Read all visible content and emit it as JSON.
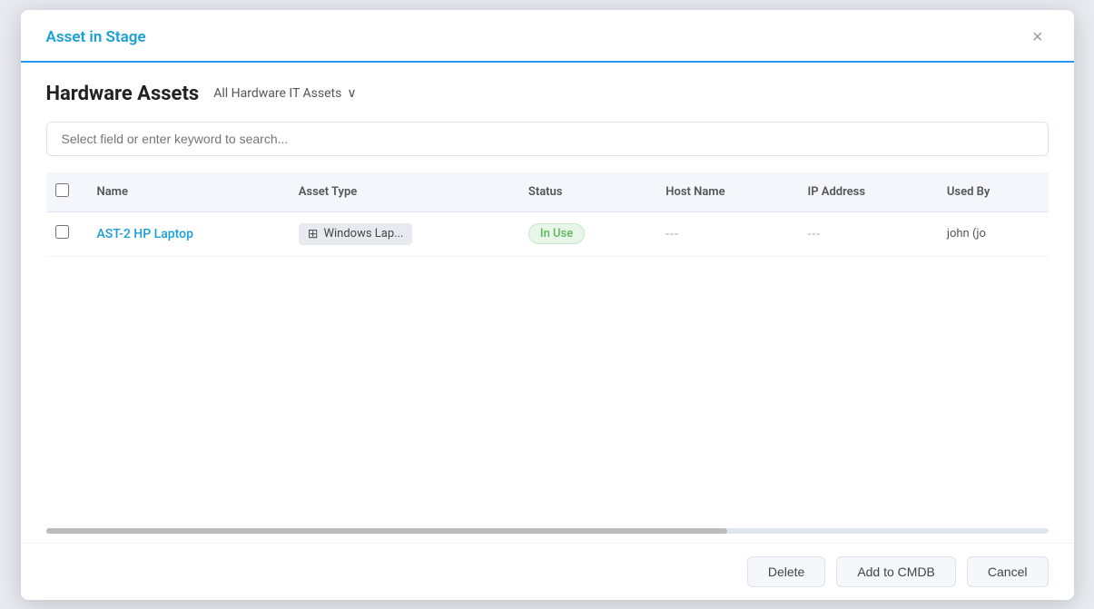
{
  "modal": {
    "title": "Asset in Stage",
    "close_label": "×"
  },
  "header": {
    "page_title": "Hardware Assets",
    "filter_label": "All Hardware IT Assets",
    "filter_chevron": "∨"
  },
  "search": {
    "placeholder": "Select field or enter keyword to search..."
  },
  "table": {
    "columns": [
      {
        "id": "checkbox",
        "label": ""
      },
      {
        "id": "name",
        "label": "Name"
      },
      {
        "id": "asset_type",
        "label": "Asset Type"
      },
      {
        "id": "status",
        "label": "Status"
      },
      {
        "id": "host_name",
        "label": "Host Name"
      },
      {
        "id": "ip_address",
        "label": "IP Address"
      },
      {
        "id": "used_by",
        "label": "Used By"
      }
    ],
    "rows": [
      {
        "name": "AST-2 HP Laptop",
        "asset_type": "Windows Lap...",
        "status": "In Use",
        "host_name": "---",
        "ip_address": "---",
        "used_by": "john (jo"
      }
    ]
  },
  "footer": {
    "delete_label": "Delete",
    "add_to_cmdb_label": "Add to CMDB",
    "cancel_label": "Cancel"
  },
  "colors": {
    "accent": "#1a9fd4",
    "status_in_use_bg": "#e8f5e9",
    "status_in_use_text": "#5cb85c"
  }
}
